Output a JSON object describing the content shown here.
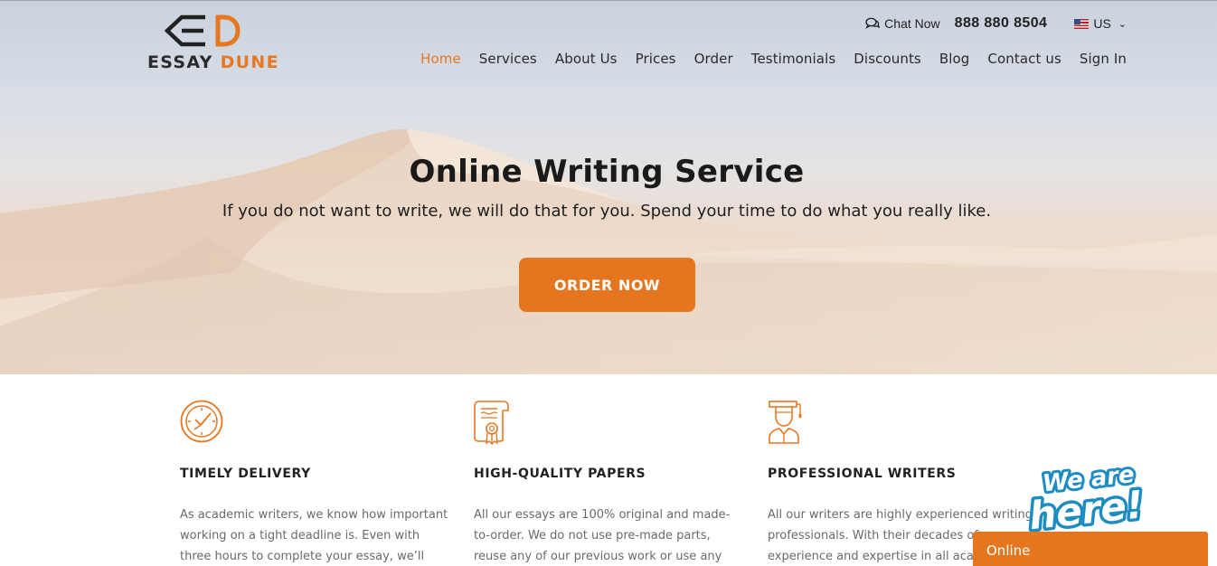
{
  "brand": {
    "logo_word1": "ESSAY",
    "logo_word2": "DUNE",
    "accent": "#e87722",
    "text_dark": "#2b2b2b"
  },
  "topbar": {
    "chat_label": "Chat Now",
    "phone": "888 880 8504",
    "locale": "US"
  },
  "nav": {
    "items": [
      {
        "label": "Home",
        "active": true
      },
      {
        "label": "Services"
      },
      {
        "label": "About Us"
      },
      {
        "label": "Prices"
      },
      {
        "label": "Order"
      },
      {
        "label": "Testimonials"
      },
      {
        "label": "Discounts"
      },
      {
        "label": "Blog"
      },
      {
        "label": "Contact us"
      },
      {
        "label": "Sign In"
      }
    ]
  },
  "hero": {
    "title": "Online Writing Service",
    "subtitle": "If you do not want to write, we will do that for you. Spend your time to do what you really like.",
    "cta_label": "ORDER NOW"
  },
  "features": [
    {
      "icon": "clock-icon",
      "title": "TIMELY DELIVERY",
      "text": "As academic writers, we know how important working on a tight deadline is. Even with three hours to complete your essay, we’ll deliver it"
    },
    {
      "icon": "certificate-icon",
      "title": "HIGH-QUALITY PAPERS",
      "text": "All our essays are 100% original and made-to-order. We do not use pre-made parts, reuse any of our previous work or use any papers"
    },
    {
      "icon": "graduate-icon",
      "title": "PROFESSIONAL WRITERS",
      "text": "All our writers are highly experienced writing professionals. With their decades of experience and expertise in all acad"
    }
  ],
  "chat_widget": {
    "badge_line1": "We are",
    "badge_line2": "here!",
    "status": "Online"
  }
}
